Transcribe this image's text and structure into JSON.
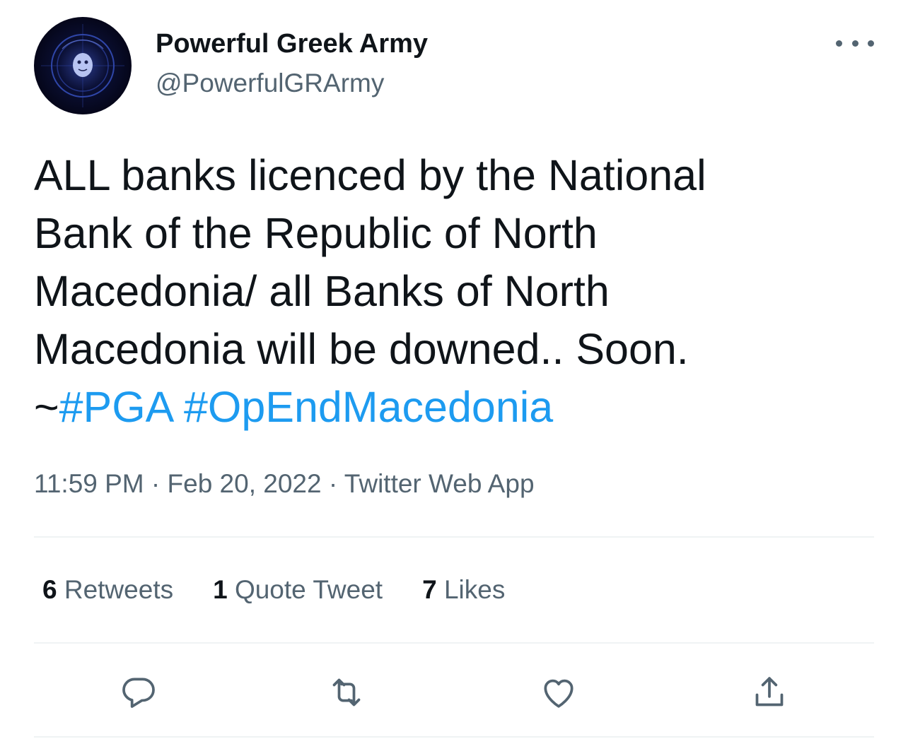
{
  "author": {
    "display_name": "Powerful Greek Army",
    "handle": "@PowerfulGRArmy"
  },
  "tweet": {
    "text_lines": [
      "ALL banks licenced by the National",
      "Bank of the Republic of North",
      "Macedonia/ all Banks of North",
      "Macedonia will be downed.. Soon."
    ],
    "prefix": "~",
    "hashtags": [
      "#PGA",
      "#OpEndMacedonia"
    ]
  },
  "meta": {
    "time": "11:59 PM",
    "separator": " · ",
    "date": "Feb 20, 2022",
    "source": "Twitter Web App"
  },
  "stats": {
    "retweets": {
      "count": "6",
      "label": "Retweets"
    },
    "quotes": {
      "count": "1",
      "label": "Quote Tweet"
    },
    "likes": {
      "count": "7",
      "label": "Likes"
    }
  },
  "icons": {
    "reply": "reply-icon",
    "retweet": "retweet-icon",
    "like": "heart-icon",
    "share": "share-icon",
    "more": "more-icon"
  },
  "colors": {
    "text": "#0f1419",
    "secondary": "#536471",
    "link": "#1d9bf0",
    "divider": "#eff3f4"
  }
}
